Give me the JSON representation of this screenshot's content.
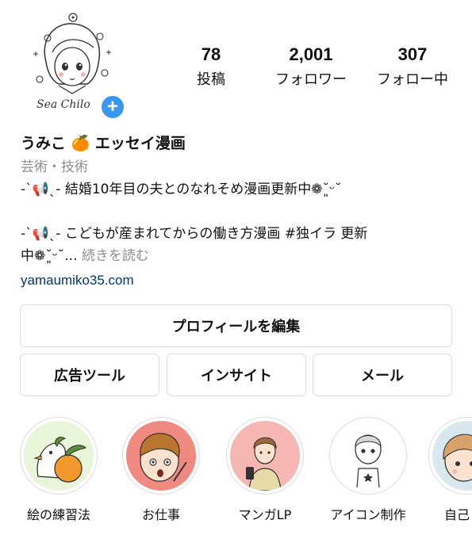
{
  "profile": {
    "avatar_icon": "avatar-illustration",
    "avatar_signature": "Sea Chilo",
    "add_icon": "plus-icon",
    "add_symbol": "+"
  },
  "stats": [
    {
      "value": "78",
      "label": "投稿"
    },
    {
      "value": "2,001",
      "label": "フォロワー"
    },
    {
      "value": "307",
      "label": "フォロー中"
    }
  ],
  "bio": {
    "name": "うみこ 🍊 エッセイ漫画",
    "category": "芸術・技術",
    "line1": "-ˋ📢ˎ- 結婚10年目の夫とのなれそめ漫画更新中❁˘͈ᵕ˘",
    "line2": "-ˋ📢ˎ- こどもが産まれてからの働き方漫画 #独イラ 更新",
    "line3": "中❁˘͈ᵕ˘...",
    "more": "続きを読む",
    "link": "yamaumiko35.com"
  },
  "buttons": {
    "edit_profile": "プロフィールを編集",
    "ad_tools": "広告ツール",
    "insights": "インサイト",
    "email": "メール"
  },
  "highlights": [
    {
      "label": "絵の練習法",
      "icon": "bird-orange-icon",
      "bg": "#e8f5d8"
    },
    {
      "label": "お仕事",
      "icon": "surprised-boy-icon",
      "bg": "#f08a80"
    },
    {
      "label": "マンガLP",
      "icon": "phone-man-icon",
      "bg": "#f6b7b3"
    },
    {
      "label": "アイコン制作",
      "icon": "boy-sketch-icon",
      "bg": "#ffffff"
    },
    {
      "label": "自己",
      "icon": "girl-face-icon",
      "bg": "#d8e8ee"
    }
  ]
}
